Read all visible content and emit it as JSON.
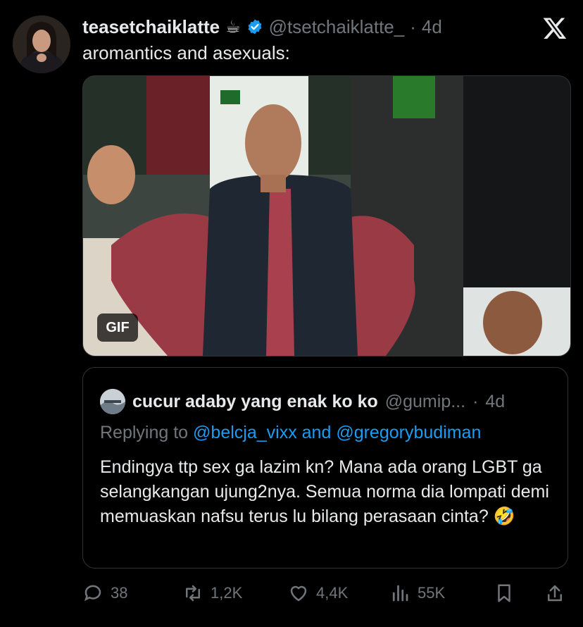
{
  "tweet": {
    "author_name": "teasetchaiklatte",
    "author_emoji": "☕",
    "verified_icon": "verified-badge-icon",
    "handle": "@tsetchaiklatte_",
    "separator": "·",
    "time": "4d",
    "text": "aromantics and asexuals:",
    "media_badge": "GIF"
  },
  "quote": {
    "author_name": "cucur adaby yang enak ko ko",
    "handle": "@gumip...",
    "separator": "·",
    "time": "4d",
    "replying_label": "Replying to",
    "mention1": "@belcja_vixx",
    "and_word": "and",
    "mention2": "@gregorybudiman",
    "text": "Endingya ttp sex ga lazim kn? Mana ada orang LGBT ga selangkangan ujung2nya. Semua norma dia lompati demi memuaskan nafsu terus lu bilang perasaan cinta? 🤣"
  },
  "actions": {
    "replies": "38",
    "reposts": "1,2K",
    "likes": "4,4K",
    "views": "55K"
  },
  "colors": {
    "background": "#000000",
    "text": "#e7e9ea",
    "muted": "#71767b",
    "accent": "#1d9bf0",
    "border": "#2f3336"
  }
}
